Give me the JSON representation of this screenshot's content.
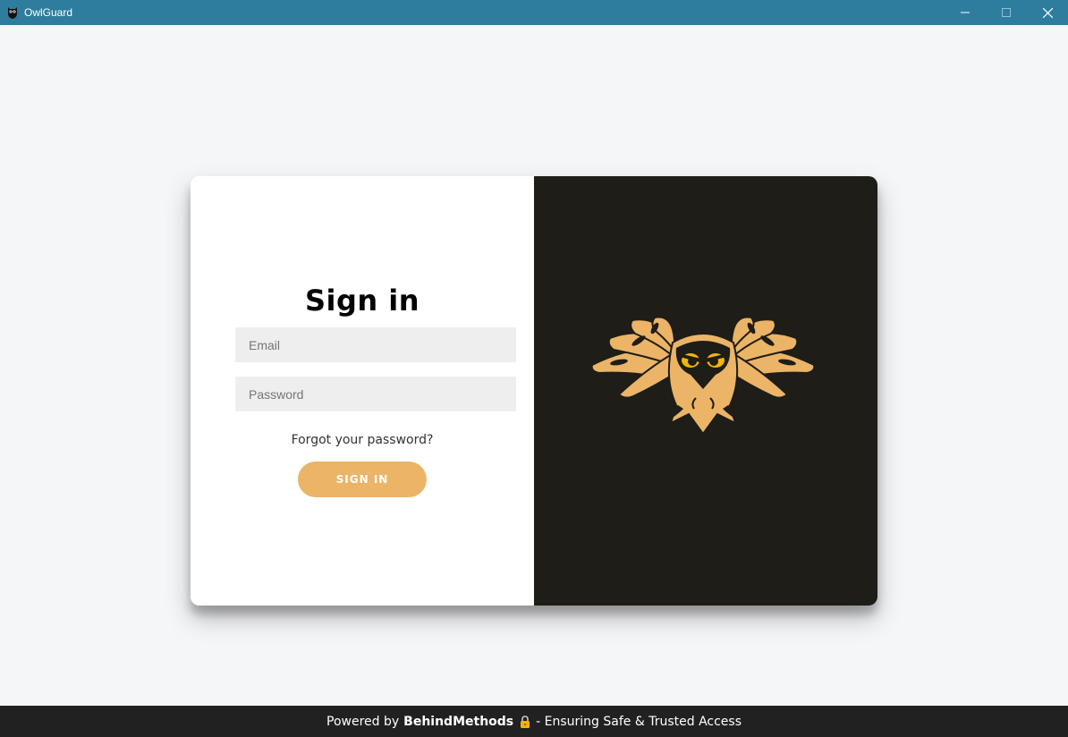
{
  "window": {
    "title": "OwlGuard",
    "app_icon": "owl-icon",
    "controls": [
      "minimize-icon",
      "maximize-icon",
      "close-icon"
    ],
    "accent_color": "#2e7d9e"
  },
  "login": {
    "heading": "Sign in",
    "email_placeholder": "Email",
    "password_placeholder": "Password",
    "forgot_label": "Forgot your password?",
    "signin_label": "SIGN IN",
    "button_color": "#ebb467",
    "art_background": "#1e1d17",
    "logo": "owl-logo"
  },
  "footer": {
    "prefix": "Powered by",
    "brand": "BehindMethods",
    "icon": "lock-icon",
    "suffix": "- Ensuring Safe & Trusted Access"
  }
}
